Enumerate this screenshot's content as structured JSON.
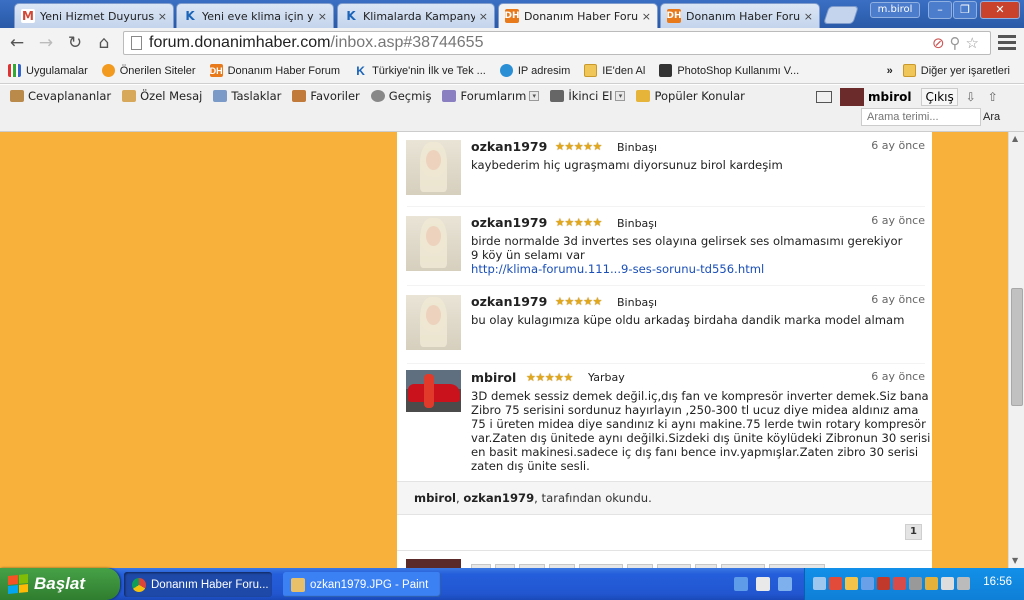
{
  "tabs": [
    {
      "label": "Yeni Hizmet Duyurusu",
      "favicon": "G",
      "type": "gmail"
    },
    {
      "label": "Yeni eve klima için yar",
      "favicon": "K",
      "type": "kf"
    },
    {
      "label": "Klimalarda Kampanya E",
      "favicon": "K",
      "type": "kf"
    },
    {
      "label": "Donanım Haber Forum",
      "favicon": "DH",
      "type": "dh"
    },
    {
      "label": "Donanım Haber Forum",
      "favicon": "DH",
      "type": "dh"
    }
  ],
  "tab_close": "×",
  "window": {
    "user": "m.birol"
  },
  "address": {
    "domain": "forum.donanimhaber.com",
    "path": "/inbox.asp#38744655"
  },
  "bookmarks": [
    {
      "label": "Uygulamalar",
      "icon": "apps-icon"
    },
    {
      "label": "Önerilen Siteler",
      "icon": "bulb-icon"
    },
    {
      "label": "Donanım Haber Forum",
      "icon": "dh-icon"
    },
    {
      "label": "Türkiye'nin İlk ve Tek ...",
      "icon": "kf-icon"
    },
    {
      "label": "IP adresim",
      "icon": "ip-icon"
    },
    {
      "label": "IE'den Al",
      "icon": "folder-icon"
    },
    {
      "label": "PhotoShop Kullanımı V...",
      "icon": "ps-icon"
    }
  ],
  "bookmarks_more": "»",
  "bookmarks_other": "Diğer yer işaretleri",
  "forum_nav": [
    {
      "label": "Cevaplananlar"
    },
    {
      "label": "Özel Mesaj"
    },
    {
      "label": "Taslaklar"
    },
    {
      "label": "Favoriler"
    },
    {
      "label": "Geçmiş"
    },
    {
      "label": "Forumlarım"
    },
    {
      "label": "İkinci El"
    },
    {
      "label": "Popüler Konular"
    }
  ],
  "forum_user": {
    "name": "mbirol",
    "logout": "Çıkış"
  },
  "search": {
    "placeholder": "Arama terimi...",
    "button": "Ara"
  },
  "messages": [
    {
      "user": "ozkan1979",
      "stars": "★★★★★",
      "rank": "Binbaşı",
      "time": "6 ay önce",
      "lines": [
        "kaybederim hiç ugraşmamı diyorsunuz birol kardeşim"
      ],
      "link": ""
    },
    {
      "user": "ozkan1979",
      "stars": "★★★★★",
      "rank": "Binbaşı",
      "time": "6 ay önce",
      "lines": [
        "birde normalde 3d invertes ses olayına gelirsek ses olmamasımı gerekiyor",
        "9 köy ün selamı var"
      ],
      "link": "http://klima-forumu.111...9-ses-sorunu-td556.html"
    },
    {
      "user": "ozkan1979",
      "stars": "★★★★★",
      "rank": "Binbaşı",
      "time": "6 ay önce",
      "lines": [
        "bu olay kulagımıza küpe oldu arkadaş birdaha dandik marka model almam"
      ],
      "link": ""
    },
    {
      "user": "mbirol",
      "stars": "★★★★★",
      "rank": "Yarbay",
      "time": "6 ay önce",
      "lines": [
        "3D demek sessiz demek değil.iç,dış fan ve kompresör inverter demek.Siz bana",
        "Zibro 75 serisini sordunuz hayırlayın ,250-300 tl ucuz diye midea aldınız ama",
        "75 i üreten midea diye sandınız ki aynı makine.75 lerde twin rotary kompresör",
        "var.Zaten dış ünitede aynı değilki.Sizdeki dış ünite köylüdeki Zibronun 30 serisi",
        "en basit makinesi.sadece iç dış fanı bence inv.yapmışlar.Zaten zibro 30 serisi",
        "zaten dış ünite sesli."
      ],
      "link": ""
    }
  ],
  "read_by": {
    "user1": "mbirol",
    "sep": ", ",
    "user2": "ozkan1979",
    "suffix": ", tarafından okundu."
  },
  "pagination": {
    "current": "1"
  },
  "taskbar": {
    "start": "Başlat",
    "items": [
      {
        "label": "Donanım Haber Foru...",
        "active": true
      },
      {
        "label": "ozkan1979.JPG - Paint",
        "active": false
      }
    ],
    "clock": "16:56"
  }
}
